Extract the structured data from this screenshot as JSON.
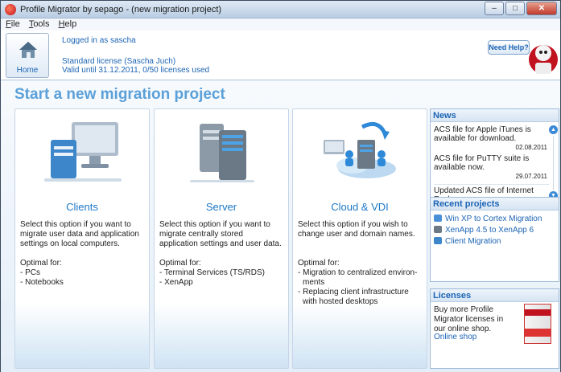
{
  "window": {
    "title": "Profile Migrator by sepago - (new migration project)",
    "controls": {
      "minimize": "–",
      "maximize": "□",
      "close": "✕"
    }
  },
  "menu": [
    {
      "label": "File",
      "access_key": "F",
      "rest": "ile"
    },
    {
      "label": "Tools",
      "access_key": "T",
      "rest": "ools"
    },
    {
      "label": "Help",
      "access_key": "H",
      "rest": "elp"
    }
  ],
  "header": {
    "home_label": "Home",
    "logged_in": "Logged in as sascha",
    "license": "Standard license  (Sascha Juch)",
    "valid": "Valid until 31.12.2011, 0/50 licenses used",
    "help_button": "Need Help?"
  },
  "main": {
    "title": "Start a new migration project",
    "options": [
      {
        "title": "Clients",
        "description": "Select this option if you want to migrate user data and application settings on local computers.",
        "optimal_label": "Optimal for:",
        "optimal": [
          "PCs",
          "Notebooks"
        ]
      },
      {
        "title": "Server",
        "description": "Select this option if you want to migrate centrally stored application settings and user data.",
        "optimal_label": "Optimal for:",
        "optimal": [
          "Terminal Services (TS/RDS)",
          "XenApp"
        ]
      },
      {
        "title": "Cloud & VDI",
        "description": "Select this option if you wish to change user and domain names.",
        "optimal_label": "Optimal for:",
        "optimal": [
          "Migration to centralized environ- ments",
          "Replacing client infrastructure with hosted desktops"
        ]
      }
    ]
  },
  "news": {
    "heading": "News",
    "items": [
      {
        "text": "ACS file for Apple iTunes is available for download.",
        "date": "02.08.2011"
      },
      {
        "text": "ACS file for PuTTY suite is available now.",
        "date": "29.07.2011"
      },
      {
        "text": "Updated ACS file of Internet Explorer.",
        "date": ""
      }
    ]
  },
  "recent": {
    "heading": "Recent projects",
    "items": [
      {
        "label": "Win XP to Cortex Migration",
        "icon": "migration-arrows-icon"
      },
      {
        "label": "XenApp 4.5 to XenApp 6",
        "icon": "server-rack-icon"
      },
      {
        "label": "Client Migration",
        "icon": "client-computer-icon"
      }
    ]
  },
  "licenses": {
    "heading": "Licenses",
    "text": "Buy more Profile Migrator licenses in our online shop.",
    "shop_link": "Online shop"
  },
  "colors": {
    "accent": "#1c64b4",
    "title_blue": "#5ba0d8",
    "card_title": "#1c78c8"
  }
}
